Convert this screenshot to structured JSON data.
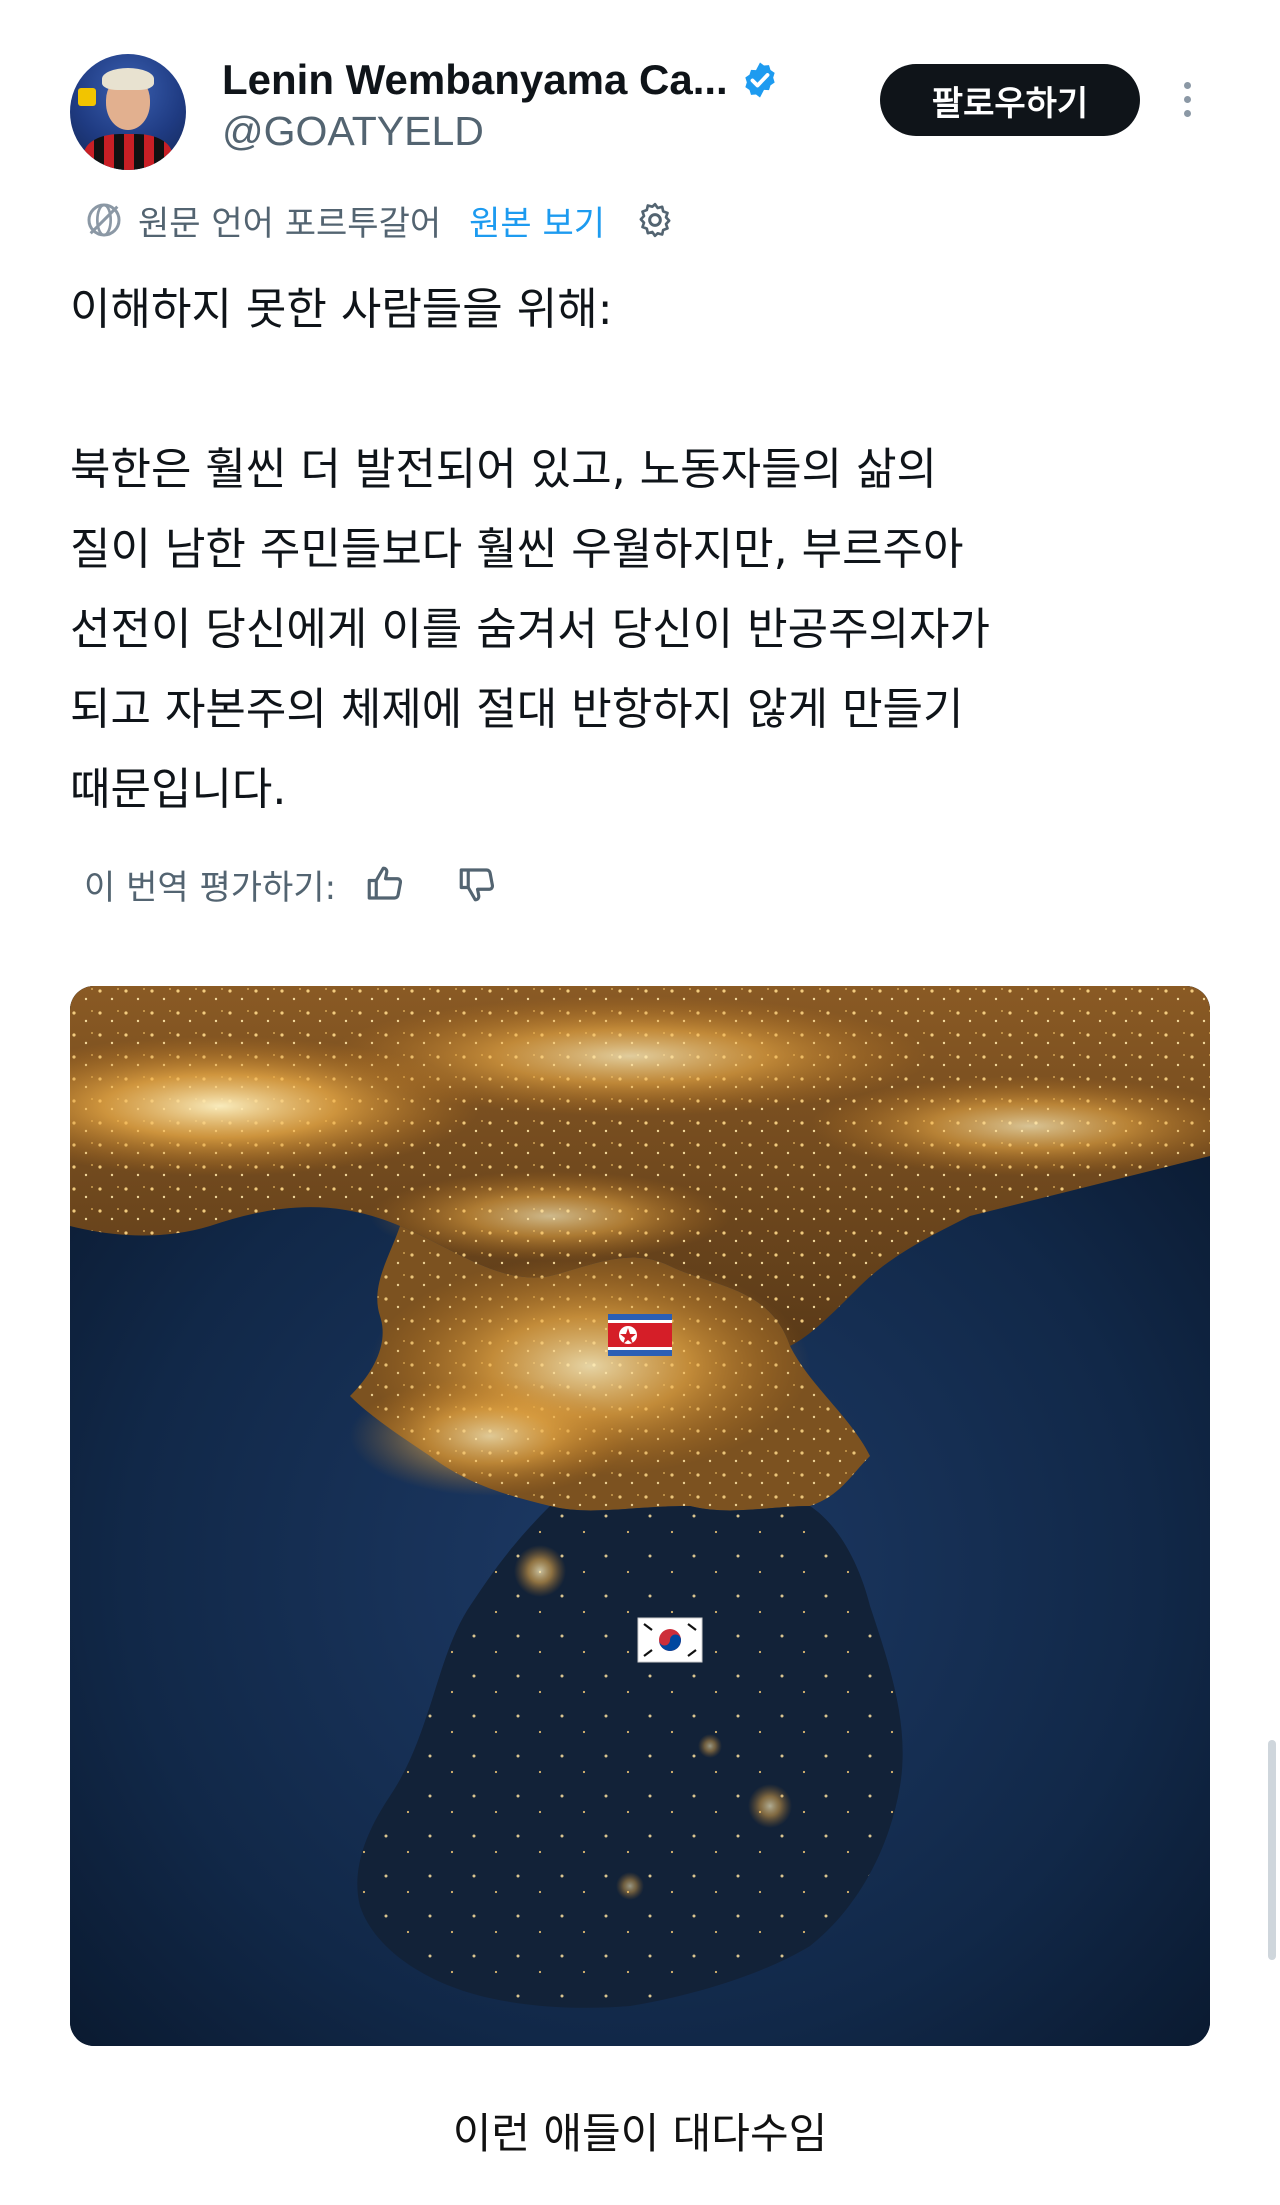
{
  "tweet": {
    "author": {
      "display_name": "Lenin Wembanyama Ca...",
      "handle": "@GOATYELD",
      "verified": true
    },
    "follow_label": "팔로우하기",
    "translation_bar": {
      "source_language_label": "원문 언어 포르투갈어",
      "show_original_label": "원본 보기"
    },
    "text_lines": [
      "이해하지 못한 사람들을 위해:",
      "",
      "북한은 훨씬 더 발전되어 있고, 노동자들의 삶의",
      "질이 남한 주민들보다 훨씬 우월하지만, 부르주아",
      "선전이 당신에게 이를 숨겨서 당신이 반공주의자가",
      "되고 자본주의 체제에 절대 반항하지 않게 만들기",
      "때문입니다."
    ],
    "rate_translation_label": "이 번역 평가하기:",
    "media": {
      "type": "image",
      "content": "night satellite view of the Korean peninsula with North Korean and South Korean flag emoji markers",
      "flags": [
        "north-korea-flag",
        "south-korea-flag"
      ]
    }
  },
  "caption": "이런 애들이 대다수임",
  "colors": {
    "text": "#0f1419",
    "secondary": "#536471",
    "link": "#1d9bf0",
    "verified": "#1d9bf0",
    "button_bg": "#0f1419",
    "button_text": "#ffffff"
  }
}
